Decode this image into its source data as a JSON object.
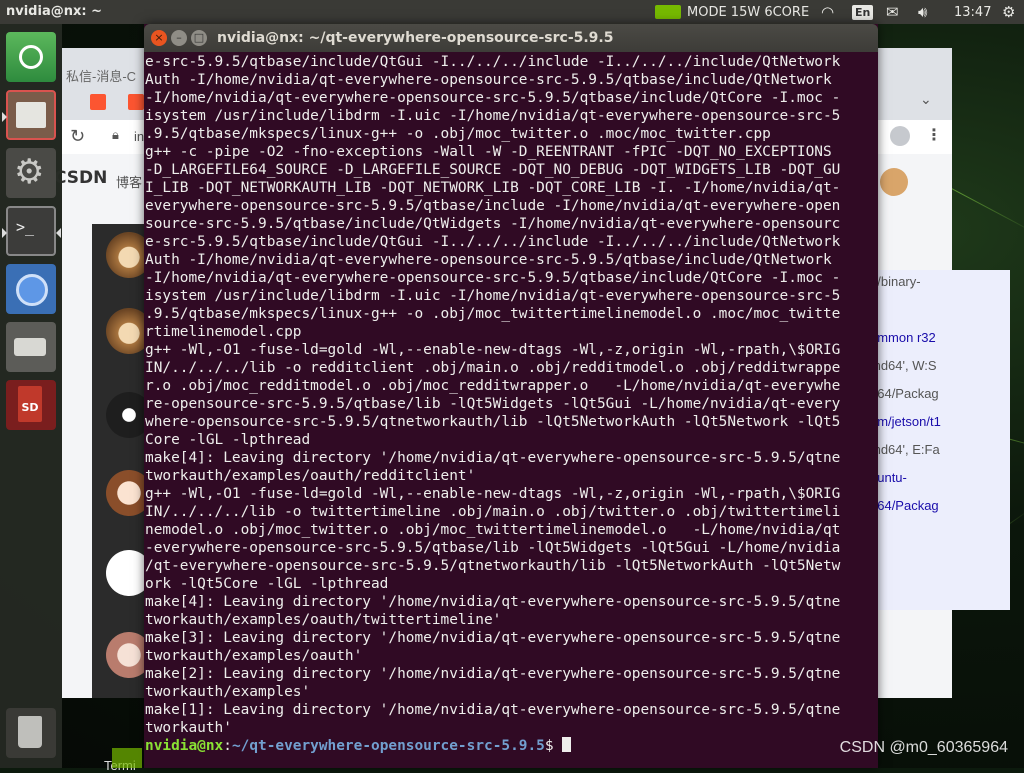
{
  "top_panel": {
    "user_host": "nvidia@nx: ~",
    "power_mode": "MODE 15W 6CORE",
    "language": "En",
    "clock": "13:47"
  },
  "launcher": {
    "items": [
      {
        "name": "ubuntu-dash-icon"
      },
      {
        "name": "files-icon"
      },
      {
        "name": "system-settings-icon"
      },
      {
        "name": "terminal-icon"
      },
      {
        "name": "chromium-icon"
      },
      {
        "name": "drive-icon"
      },
      {
        "name": "sd-card-icon",
        "label": "SD"
      },
      {
        "name": "trash-icon"
      }
    ]
  },
  "background_browser": {
    "tab_title": "私信-消息-C",
    "address_partial": "in",
    "brand": "CSDN",
    "nav_item": "博客",
    "right_pane_fragments": [
      "n/binary-",
      "ommon r32",
      "md64', W:S",
      "d64/Packag",
      "om/jetson/t1",
      "md64', E:Fa",
      "buntu-",
      "d64/Packag"
    ],
    "chat_label": "Termi"
  },
  "terminal": {
    "window_title": "nvidia@nx: ~/qt-everywhere-opensource-src-5.9.5",
    "lines": [
      "e-src-5.9.5/qtbase/include/QtGui -I../../../include -I../../../include/QtNetwork",
      "Auth -I/home/nvidia/qt-everywhere-opensource-src-5.9.5/qtbase/include/QtNetwork",
      "-I/home/nvidia/qt-everywhere-opensource-src-5.9.5/qtbase/include/QtCore -I.moc -",
      "isystem /usr/include/libdrm -I.uic -I/home/nvidia/qt-everywhere-opensource-src-5",
      ".9.5/qtbase/mkspecs/linux-g++ -o .obj/moc_twitter.o .moc/moc_twitter.cpp",
      "g++ -c -pipe -O2 -fno-exceptions -Wall -W -D_REENTRANT -fPIC -DQT_NO_EXCEPTIONS",
      "-D_LARGEFILE64_SOURCE -D_LARGEFILE_SOURCE -DQT_NO_DEBUG -DQT_WIDGETS_LIB -DQT_GU",
      "I_LIB -DQT_NETWORKAUTH_LIB -DQT_NETWORK_LIB -DQT_CORE_LIB -I. -I/home/nvidia/qt-",
      "everywhere-opensource-src-5.9.5/qtbase/include -I/home/nvidia/qt-everywhere-open",
      "source-src-5.9.5/qtbase/include/QtWidgets -I/home/nvidia/qt-everywhere-opensourc",
      "e-src-5.9.5/qtbase/include/QtGui -I../../../include -I../../../include/QtNetwork",
      "Auth -I/home/nvidia/qt-everywhere-opensource-src-5.9.5/qtbase/include/QtNetwork",
      "-I/home/nvidia/qt-everywhere-opensource-src-5.9.5/qtbase/include/QtCore -I.moc -",
      "isystem /usr/include/libdrm -I.uic -I/home/nvidia/qt-everywhere-opensource-src-5",
      ".9.5/qtbase/mkspecs/linux-g++ -o .obj/moc_twittertimelinemodel.o .moc/moc_twitte",
      "rtimelinemodel.cpp",
      "g++ -Wl,-O1 -fuse-ld=gold -Wl,--enable-new-dtags -Wl,-z,origin -Wl,-rpath,\\$ORIG",
      "IN/../../../lib -o redditclient .obj/main.o .obj/redditmodel.o .obj/redditwrappe",
      "r.o .obj/moc_redditmodel.o .obj/moc_redditwrapper.o   -L/home/nvidia/qt-everywhe",
      "re-opensource-src-5.9.5/qtbase/lib -lQt5Widgets -lQt5Gui -L/home/nvidia/qt-every",
      "where-opensource-src-5.9.5/qtnetworkauth/lib -lQt5NetworkAuth -lQt5Network -lQt5",
      "Core -lGL -lpthread",
      "make[4]: Leaving directory '/home/nvidia/qt-everywhere-opensource-src-5.9.5/qtne",
      "tworkauth/examples/oauth/redditclient'",
      "g++ -Wl,-O1 -fuse-ld=gold -Wl,--enable-new-dtags -Wl,-z,origin -Wl,-rpath,\\$ORIG",
      "IN/../../../lib -o twittertimeline .obj/main.o .obj/twitter.o .obj/twittertimeli",
      "nemodel.o .obj/moc_twitter.o .obj/moc_twittertimelinemodel.o   -L/home/nvidia/qt",
      "-everywhere-opensource-src-5.9.5/qtbase/lib -lQt5Widgets -lQt5Gui -L/home/nvidia",
      "/qt-everywhere-opensource-src-5.9.5/qtnetworkauth/lib -lQt5NetworkAuth -lQt5Netw",
      "ork -lQt5Core -lGL -lpthread",
      "make[4]: Leaving directory '/home/nvidia/qt-everywhere-opensource-src-5.9.5/qtne",
      "tworkauth/examples/oauth/twittertimeline'",
      "make[3]: Leaving directory '/home/nvidia/qt-everywhere-opensource-src-5.9.5/qtne",
      "tworkauth/examples/oauth'",
      "make[2]: Leaving directory '/home/nvidia/qt-everywhere-opensource-src-5.9.5/qtne",
      "tworkauth/examples'",
      "make[1]: Leaving directory '/home/nvidia/qt-everywhere-opensource-src-5.9.5/qtne",
      "tworkauth'"
    ],
    "prompt": {
      "user_host": "nvidia@nx",
      "separator": ":",
      "path": "~/qt-everywhere-opensource-src-5.9.5",
      "symbol": "$ "
    }
  },
  "watermark": "CSDN @m0_60365964",
  "colors": {
    "terminal_bg": "#300a24",
    "prompt_green": "#8ae234",
    "prompt_blue": "#729fcf",
    "close_orange": "#e95420"
  }
}
